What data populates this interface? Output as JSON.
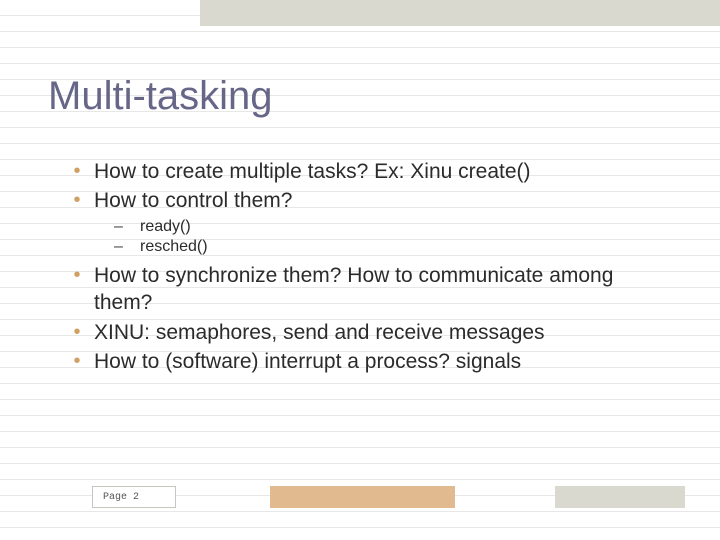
{
  "title": "Multi-tasking",
  "bullets": {
    "b1": "How to create multiple tasks? Ex: Xinu create()",
    "b2": "How to control them?",
    "sub1": "ready()",
    "sub2": "resched()",
    "b3": "How to synchronize them? How to communicate among them?",
    "b4": "XINU: semaphores, send and receive messages",
    "b5": "How to (software) interrupt a process? signals"
  },
  "footer": {
    "page_label": "Page 2"
  },
  "colors": {
    "title_color": "#666688",
    "bullet_accent": "#d0a060",
    "banner_gray": "#d9d9cf",
    "accent_tan": "#e1ba8f"
  }
}
